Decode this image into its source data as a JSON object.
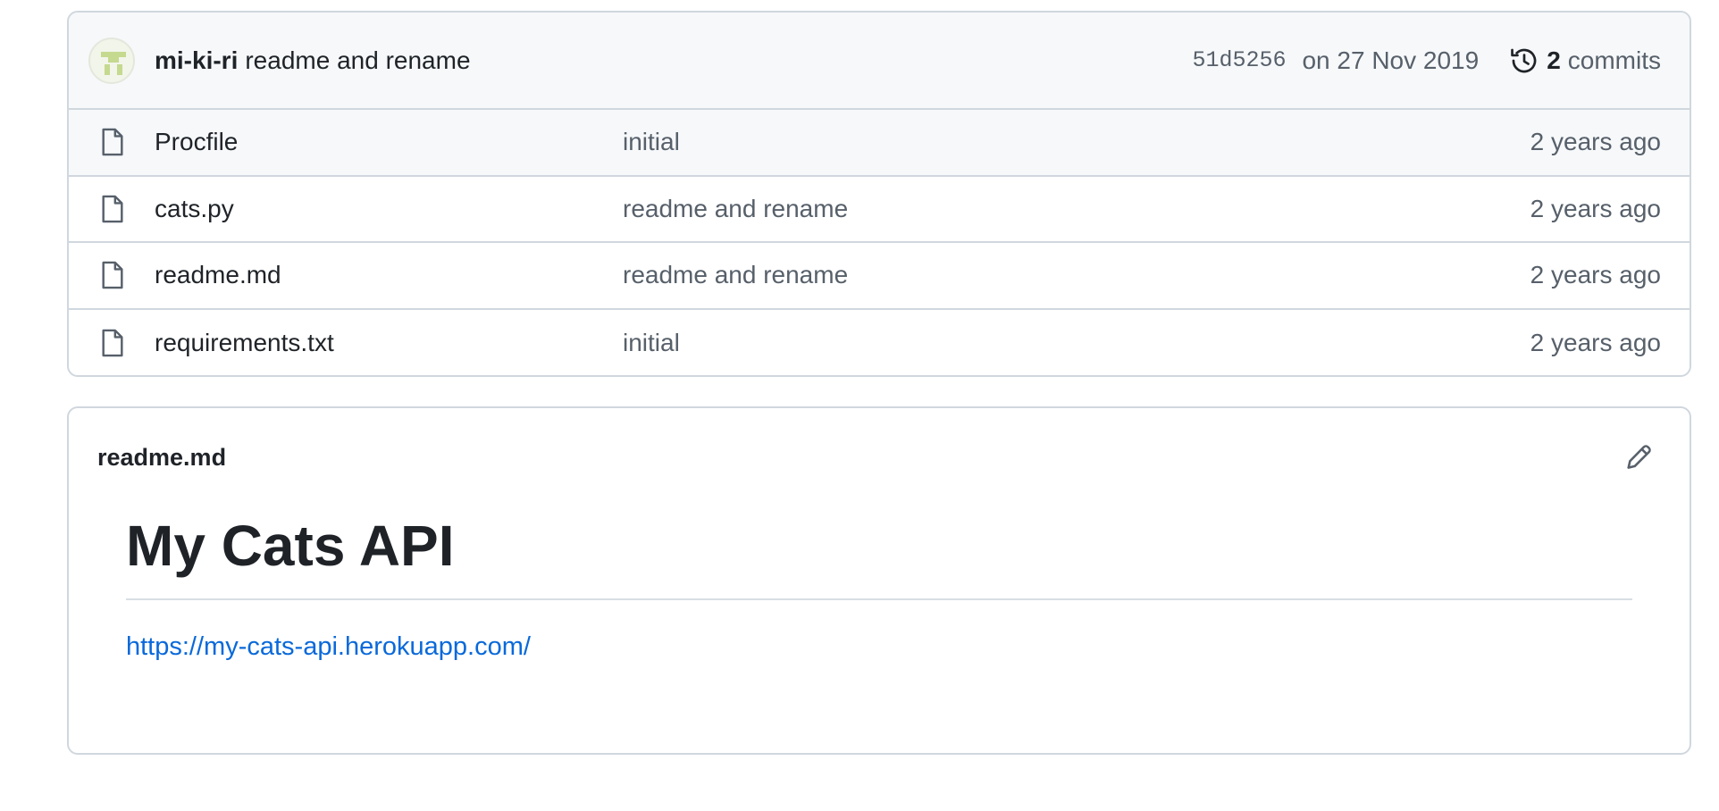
{
  "latest_commit": {
    "author": "mi-ki-ri",
    "message": "readme and rename",
    "sha": "51d5256",
    "date": "on 27 Nov 2019",
    "commits_count": "2",
    "commits_label": "commits",
    "avatar_icon": "identicon-avatar",
    "history_icon": "history-icon"
  },
  "files": [
    {
      "name": "Procfile",
      "commit_message": "initial",
      "age": "2 years ago",
      "icon": "file-icon"
    },
    {
      "name": "cats.py",
      "commit_message": "readme and rename",
      "age": "2 years ago",
      "icon": "file-icon"
    },
    {
      "name": "readme.md",
      "commit_message": "readme and rename",
      "age": "2 years ago",
      "icon": "file-icon"
    },
    {
      "name": "requirements.txt",
      "commit_message": "initial",
      "age": "2 years ago",
      "icon": "file-icon"
    }
  ],
  "readme": {
    "filename": "readme.md",
    "edit_icon": "pencil-icon",
    "title": "My Cats API",
    "link": "https://my-cats-api.herokuapp.com/"
  },
  "colors": {
    "link": "#0969da",
    "muted": "#57606a",
    "text": "#1f2328",
    "border": "#d0d7de",
    "header_bg": "#f6f8fa",
    "avatar_green": "#c5d98f"
  }
}
